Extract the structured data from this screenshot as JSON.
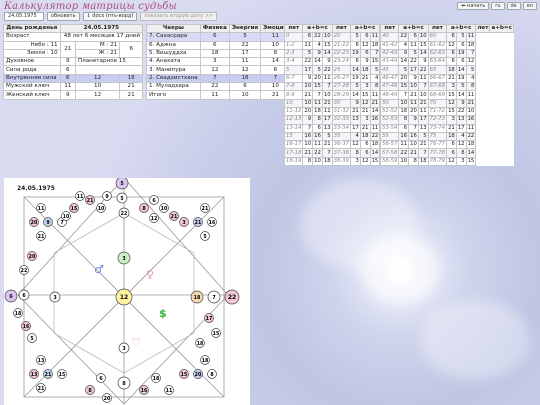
{
  "app": {
    "title": "Калькулятор матрицы судьбы",
    "date_value": "24.05.1975",
    "btn_update": "обновить",
    "btn_doc": "⇓ docx (пть-ворд)",
    "btn_child": "показать вторую дату >>",
    "lang": [
      "⬅ начать",
      "ru",
      "de",
      "en"
    ]
  },
  "personal": {
    "head": [
      "День рожденья",
      "24.05.1975"
    ],
    "age": [
      "Возраст",
      "48 лет 6 месяцев 17 дней"
    ],
    "sky": [
      "Небо : 11",
      "21",
      "М : 21",
      "6"
    ],
    "earth": [
      "Земля : 10",
      "",
      "Ж : 21",
      ""
    ],
    "rows": [
      [
        "Духовное",
        "9",
        "Планетарное 15"
      ],
      [
        "Сила рода",
        "6",
        ""
      ]
    ],
    "tri_head": [
      "Внутренняя сила",
      "6",
      "12",
      "18"
    ],
    "tri": [
      [
        "Мужской ключ",
        "11",
        "10",
        "21"
      ],
      [
        "Женский ключ",
        "9",
        "12",
        "21"
      ]
    ]
  },
  "chakras": {
    "head": [
      "Чакры",
      "Физика",
      "Энергия",
      "Эмоции"
    ],
    "rows": [
      [
        "7. Сахасрара",
        "6",
        "5",
        "11"
      ],
      [
        "6. Аджна",
        "6",
        "22",
        "10"
      ],
      [
        "5. Вишуддха",
        "18",
        "17",
        "8"
      ],
      [
        "4. Анахата",
        "3",
        "11",
        "14"
      ],
      [
        "3. Манипура",
        "12",
        "12",
        "6"
      ],
      [
        "2. Свадхистхана",
        "7",
        "18",
        "7"
      ],
      [
        "1. Муладхара",
        "22",
        "6",
        "10"
      ],
      [
        "Итого",
        "11",
        "10",
        "21"
      ]
    ]
  },
  "years_left": {
    "head": [
      "лет",
      "a+b=c",
      "лет",
      "a+b=c",
      "лет",
      "a+b=c"
    ],
    "rows": [
      [
        "0",
        "6",
        "22",
        "10",
        "20",
        "5",
        "6",
        "11"
      ],
      [
        "1-2",
        "11",
        "4",
        "15",
        "21-22",
        "6",
        "12",
        "18"
      ],
      [
        "2-3",
        "5",
        "9",
        "14",
        "22-23",
        "19",
        "6",
        "7"
      ],
      [
        "3-4",
        "22",
        "14",
        "9",
        "23-24",
        "6",
        "9",
        "15"
      ],
      [
        "5",
        "17",
        "5",
        "22",
        "25",
        "14",
        "18",
        "5"
      ],
      [
        "6-7",
        "9",
        "20",
        "11",
        "26-27",
        "19",
        "21",
        "4"
      ],
      [
        "7-8",
        "10",
        "15",
        "7",
        "27-28",
        "5",
        "3",
        "8"
      ],
      [
        "8-9",
        "21",
        "7",
        "10",
        "28-29",
        "14",
        "15",
        "11"
      ],
      [
        "10",
        "10",
        "11",
        "21",
        "30",
        "9",
        "12",
        "21"
      ],
      [
        "11-12",
        "20",
        "18",
        "11",
        "31-32",
        "21",
        "21",
        "14"
      ],
      [
        "12-13",
        "9",
        "8",
        "17",
        "32-33",
        "13",
        "3",
        "16"
      ],
      [
        "13-14",
        "7",
        "6",
        "13",
        "33-34",
        "17",
        "21",
        "11"
      ],
      [
        "15",
        "16",
        "16",
        "5",
        "35",
        "4",
        "18",
        "22"
      ],
      [
        "16-17",
        "10",
        "11",
        "21",
        "36-37",
        "12",
        "6",
        "18"
      ],
      [
        "17-18",
        "21",
        "22",
        "7",
        "37-38",
        "8",
        "6",
        "14"
      ],
      [
        "18-19",
        "8",
        "10",
        "18",
        "38-39",
        "3",
        "12",
        "15"
      ]
    ]
  },
  "years_right": {
    "head": [
      "лет",
      "a+b=c",
      "лет",
      "a+b=c",
      "лет",
      "a+b=c"
    ],
    "rows": [
      [
        "40",
        "22",
        "6",
        "10",
        "60",
        "6",
        "5",
        "11"
      ],
      [
        "41-42",
        "4",
        "11",
        "15",
        "61-62",
        "12",
        "6",
        "18"
      ],
      [
        "42-43",
        "9",
        "5",
        "14",
        "62-63",
        "6",
        "19",
        "7"
      ],
      [
        "43-44",
        "14",
        "22",
        "9",
        "63-64",
        "6",
        "6",
        "12"
      ],
      [
        "45",
        "5",
        "17",
        "22",
        "65",
        "18",
        "14",
        "5"
      ],
      [
        "46-47",
        "20",
        "9",
        "11",
        "66-67",
        "21",
        "19",
        "4"
      ],
      [
        "47-48",
        "15",
        "10",
        "7",
        "67-68",
        "3",
        "5",
        "8"
      ],
      [
        "48-49",
        "7",
        "21",
        "10",
        "68-69",
        "15",
        "14",
        "11"
      ],
      [
        "50",
        "10",
        "11",
        "21",
        "70",
        "12",
        "9",
        "21"
      ],
      [
        "51-52",
        "18",
        "20",
        "11",
        "71-72",
        "15",
        "22",
        "10"
      ],
      [
        "52-53",
        "8",
        "9",
        "17",
        "72-73",
        "3",
        "13",
        "16"
      ],
      [
        "53-54",
        "6",
        "7",
        "13",
        "73-74",
        "21",
        "17",
        "11"
      ],
      [
        "55",
        "16",
        "16",
        "5",
        "75",
        "18",
        "4",
        "22"
      ],
      [
        "56-57",
        "11",
        "10",
        "21",
        "76-77",
        "6",
        "12",
        "18"
      ],
      [
        "57-58",
        "22",
        "21",
        "7",
        "77-78",
        "6",
        "8",
        "14"
      ],
      [
        "58-59",
        "10",
        "8",
        "18",
        "78-79",
        "12",
        "3",
        "15"
      ]
    ]
  },
  "matrix": {
    "date": "24.05.1975",
    "center": "12",
    "left": "6",
    "right": "7",
    "top": "5",
    "bottom": "8",
    "far_left": "6",
    "far_right": "22",
    "far_top": "5",
    "inner_left": "11",
    "inner_right": "18",
    "inner_top": "22",
    "inner_bottom": "3",
    "green": "3",
    "dollar_green": "$",
    "corner_tl": [
      "20",
      "9",
      "7",
      "11",
      "21"
    ],
    "corner_tr": [
      "3",
      "21",
      "16",
      "21",
      "5"
    ],
    "corner_bl": [
      "13",
      "21",
      "15",
      "13",
      "21"
    ],
    "corner_br": [
      "15",
      "20",
      "8",
      "18"
    ],
    "side_tl": [
      "21",
      "10",
      "9",
      "15",
      "10",
      "11"
    ],
    "side_tr": [
      "8",
      "6",
      "10",
      "21",
      "12"
    ],
    "side_l": [
      "20",
      "22",
      "18",
      "16",
      "5"
    ],
    "side_r": [
      "17",
      "15",
      "18"
    ],
    "side_b": [
      "8",
      "6",
      "20",
      "16",
      "18",
      "11"
    ],
    "colors": {
      "pink": "#f2c6d6",
      "blue": "#c3d2f2",
      "yellow": "#fff3a0",
      "green": "#c8f0c0",
      "orange": "#f3d9b3",
      "violet": "#d9c6ef"
    }
  }
}
